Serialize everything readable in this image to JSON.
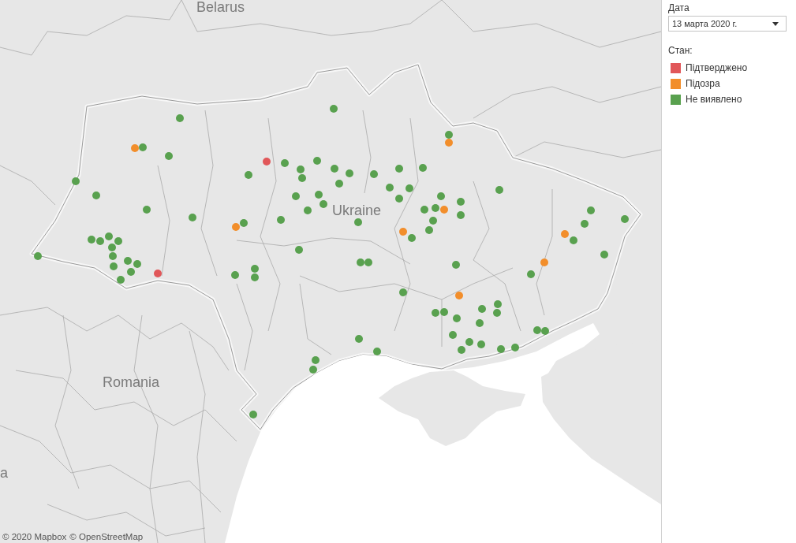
{
  "map": {
    "labels": [
      "Belarus",
      "Ukraine",
      "Romania",
      "a"
    ],
    "points": [
      {
        "color": "#59a14f"
      },
      {
        "color": "#59a14f"
      },
      {
        "color": "#f28e2b"
      },
      {
        "color": "#59a14f"
      },
      {
        "color": "#59a14f"
      },
      {
        "color": "#59a14f"
      },
      {
        "color": "#59a14f"
      },
      {
        "color": "#59a14f"
      },
      {
        "color": "#59a14f"
      },
      {
        "color": "#59a14f"
      },
      {
        "color": "#59a14f"
      },
      {
        "color": "#59a14f"
      },
      {
        "color": "#59a14f"
      },
      {
        "color": "#59a14f"
      },
      {
        "color": "#59a14f"
      },
      {
        "color": "#59a14f"
      },
      {
        "color": "#59a14f"
      },
      {
        "color": "#59a14f"
      },
      {
        "color": "#59a14f"
      },
      {
        "color": "#59a14f"
      },
      {
        "color": "#e15759"
      },
      {
        "color": "#e15759"
      },
      {
        "color": "#59a14f"
      },
      {
        "color": "#59a14f"
      },
      {
        "color": "#59a14f"
      },
      {
        "color": "#59a14f"
      },
      {
        "color": "#59a14f"
      },
      {
        "color": "#59a14f"
      },
      {
        "color": "#59a14f"
      },
      {
        "color": "#59a14f"
      },
      {
        "color": "#59a14f"
      },
      {
        "color": "#59a14f"
      },
      {
        "color": "#59a14f"
      },
      {
        "color": "#59a14f"
      },
      {
        "color": "#59a14f"
      },
      {
        "color": "#59a14f"
      },
      {
        "color": "#59a14f"
      },
      {
        "color": "#f28e2b"
      },
      {
        "color": "#59a14f"
      },
      {
        "color": "#59a14f"
      },
      {
        "color": "#59a14f"
      },
      {
        "color": "#59a14f"
      },
      {
        "color": "#59a14f"
      },
      {
        "color": "#59a14f"
      },
      {
        "color": "#59a14f"
      },
      {
        "color": "#59a14f"
      },
      {
        "color": "#59a14f"
      },
      {
        "color": "#59a14f"
      },
      {
        "color": "#59a14f"
      },
      {
        "color": "#59a14f"
      },
      {
        "color": "#59a14f"
      },
      {
        "color": "#59a14f"
      },
      {
        "color": "#f28e2b"
      },
      {
        "color": "#59a14f"
      },
      {
        "color": "#59a14f"
      },
      {
        "color": "#59a14f"
      },
      {
        "color": "#59a14f"
      },
      {
        "color": "#f28e2b"
      },
      {
        "color": "#59a14f"
      },
      {
        "color": "#59a14f"
      },
      {
        "color": "#59a14f"
      },
      {
        "color": "#59a14f"
      },
      {
        "color": "#f28e2b"
      },
      {
        "color": "#59a14f"
      },
      {
        "color": "#59a14f"
      },
      {
        "color": "#59a14f"
      },
      {
        "color": "#f28e2b"
      },
      {
        "color": "#59a14f"
      },
      {
        "color": "#59a14f"
      },
      {
        "color": "#59a14f"
      },
      {
        "color": "#59a14f"
      },
      {
        "color": "#59a14f"
      },
      {
        "color": "#59a14f"
      },
      {
        "color": "#59a14f"
      },
      {
        "color": "#59a14f"
      },
      {
        "color": "#59a14f"
      },
      {
        "color": "#59a14f"
      },
      {
        "color": "#59a14f"
      },
      {
        "color": "#59a14f"
      },
      {
        "color": "#59a14f"
      },
      {
        "color": "#59a14f"
      },
      {
        "color": "#59a14f"
      },
      {
        "color": "#59a14f"
      },
      {
        "color": "#f28e2b"
      },
      {
        "color": "#59a14f"
      },
      {
        "color": "#f28e2b"
      },
      {
        "color": "#59a14f"
      },
      {
        "color": "#59a14f"
      },
      {
        "color": "#59a14f"
      },
      {
        "color": "#59a14f"
      },
      {
        "color": "#59a14f"
      },
      {
        "color": "#59a14f"
      },
      {
        "color": "#59a14f"
      },
      {
        "color": "#59a14f"
      },
      {
        "color": "#59a14f"
      }
    ],
    "attribution": [
      "© 2020 Mapbox",
      "© OpenStreetMap"
    ]
  },
  "date_filter": {
    "label": "Дата",
    "value": "13 марта 2020 г."
  },
  "legend": {
    "title": "Стан:",
    "items": [
      {
        "label": "Підтверджено",
        "color": "#e15759"
      },
      {
        "label": "Підозра",
        "color": "#f28e2b"
      },
      {
        "label": "Не виявлено",
        "color": "#59a14f"
      }
    ]
  }
}
